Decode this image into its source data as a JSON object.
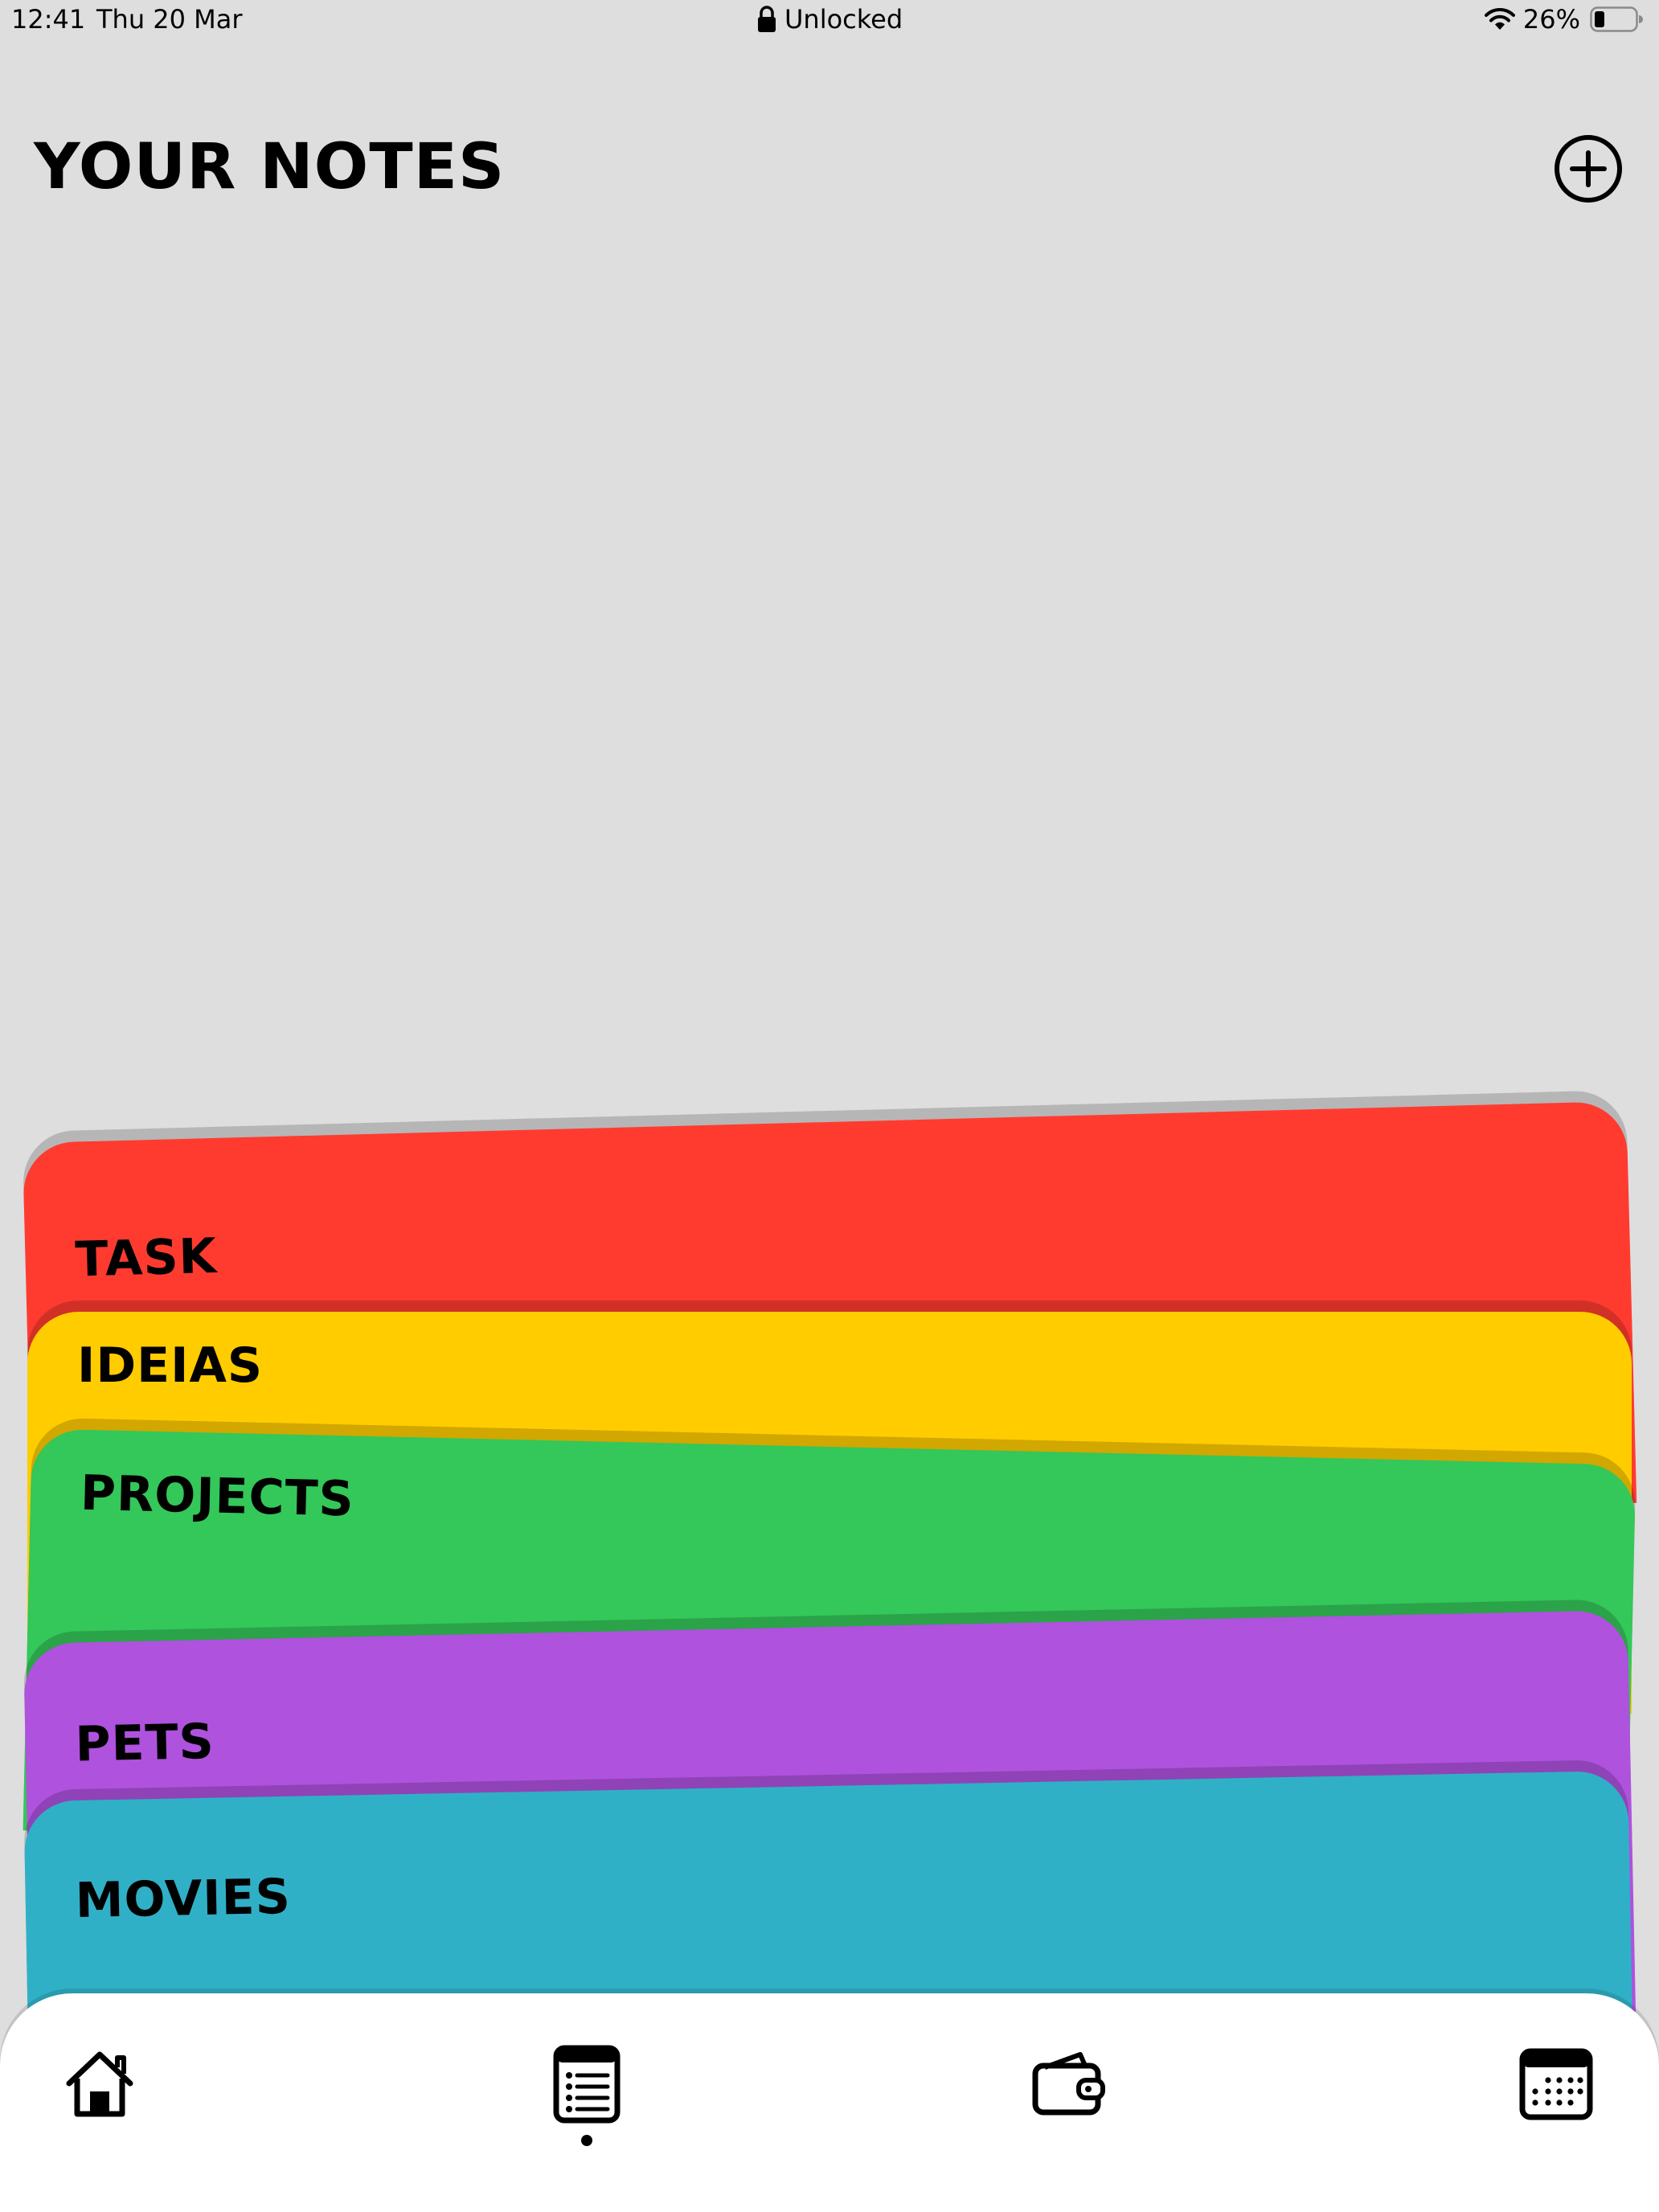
{
  "status_bar": {
    "time": "12:41",
    "date": "Thu 20 Mar",
    "lock_text": "Unlocked",
    "lock_icon": "lock-icon",
    "wifi_icon": "wifi-icon",
    "battery_percent": "26%",
    "battery_level": 0.26
  },
  "header": {
    "title": "YOUR NOTES",
    "add_icon": "plus-circle-icon"
  },
  "folders": [
    {
      "label": "TASK",
      "color": "#ff3b30"
    },
    {
      "label": "IDEIAS",
      "color": "#ffcc00"
    },
    {
      "label": "PROJECTS",
      "color": "#34c759"
    },
    {
      "label": "PETS",
      "color": "#af52de"
    },
    {
      "label": "MOVIES",
      "color": "#30b0c7"
    }
  ],
  "tab_bar": {
    "tabs": [
      {
        "icon": "home-icon"
      },
      {
        "icon": "notes-list-icon",
        "active": true
      },
      {
        "icon": "wallet-icon"
      },
      {
        "icon": "calendar-icon"
      }
    ]
  },
  "colors": {
    "background": "#dedede",
    "tab_bar": "#ffffff",
    "text": "#000000"
  }
}
